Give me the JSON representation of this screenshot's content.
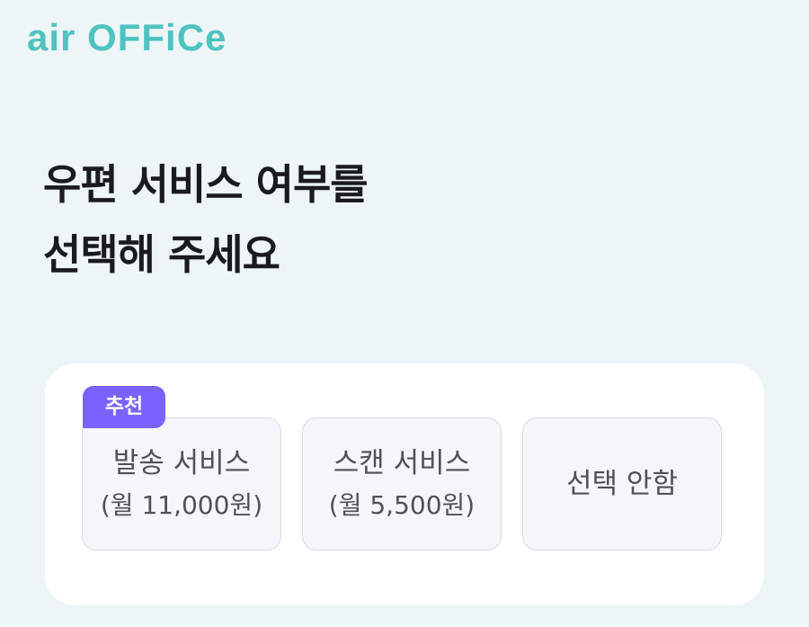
{
  "brand": {
    "logo_text": "air OFFiCe",
    "color": "#4fc3c0"
  },
  "heading": {
    "line1": "우편 서비스 여부를",
    "line2": "선택해 주세요"
  },
  "options": [
    {
      "badge": "추천",
      "title": "발송 서비스",
      "price": "(월 11,000원)"
    },
    {
      "title": "스캔 서비스",
      "price": "(월 5,500원)"
    },
    {
      "title": "선택 안함"
    }
  ],
  "colors": {
    "background": "#eef5f6",
    "card": "#ffffff",
    "badge": "#7b61ff",
    "option_border": "#dcdde5",
    "option_text": "#505058"
  }
}
